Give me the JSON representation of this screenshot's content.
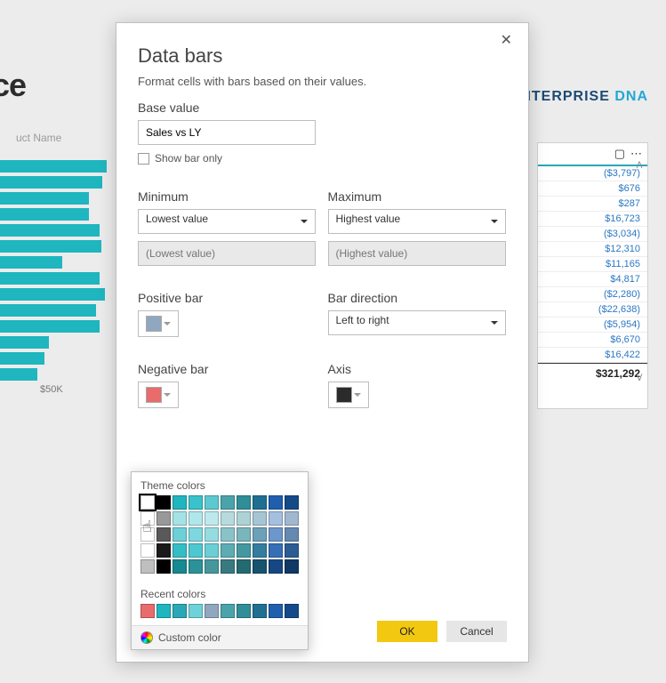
{
  "bg": {
    "title_fragment": "nce",
    "uct_label": "uct Name",
    "tick": "$50K",
    "logo_left": "NTERPRISE",
    "logo_right": " DNA",
    "bars_w": [
      120,
      115,
      100,
      100,
      112,
      114,
      70,
      112,
      118,
      108,
      112,
      55,
      50,
      42
    ]
  },
  "table": {
    "rows": [
      {
        "v": "($3,797)",
        "neg": true
      },
      {
        "v": "$676"
      },
      {
        "v": "$287"
      },
      {
        "v": "$16,723"
      },
      {
        "v": "($3,034)",
        "neg": true
      },
      {
        "v": "$12,310"
      },
      {
        "v": "$11,165"
      },
      {
        "v": "$4,817"
      },
      {
        "v": "($2,280)",
        "neg": true
      },
      {
        "v": "($22,638)",
        "neg": true
      },
      {
        "v": "($5,954)",
        "neg": true
      },
      {
        "v": "$6,670"
      },
      {
        "v": "$16,422"
      }
    ],
    "total": "$321,292"
  },
  "dlg": {
    "title": "Data bars",
    "subtitle": "Format cells with bars based on their values.",
    "base_label": "Base value",
    "base_value": "Sales vs LY",
    "show_bar_only": "Show bar only",
    "min_label": "Minimum",
    "max_label": "Maximum",
    "min_select": "Lowest value",
    "max_select": "Highest value",
    "min_placeholder": "(Lowest value)",
    "max_placeholder": "(Highest value)",
    "pos_label": "Positive bar",
    "dir_label": "Bar direction",
    "dir_select": "Left to right",
    "neg_label": "Negative bar",
    "axis_label": "Axis",
    "ok": "OK",
    "cancel": "Cancel",
    "pos_color": "#8fa8bf",
    "neg_color": "#e86c6c",
    "axis_color": "#2b2b2b"
  },
  "picker": {
    "theme_label": "Theme colors",
    "recent_label": "Recent colors",
    "custom_label": "Custom color",
    "theme_base": [
      "#ffffff",
      "#000000",
      "#1fb6c0",
      "#39c2cc",
      "#5cc9d0",
      "#4aa3ab",
      "#2f8e97",
      "#1f6f93",
      "#1f5fae",
      "#144a87"
    ],
    "recent": [
      "#e86c6c",
      "#1fb6c0",
      "#2aa8b5",
      "#6fd2d8",
      "#8fa8bf",
      "#4aa3ab",
      "#2f8e97",
      "#1f6f93",
      "#1f5fae",
      "#144a87"
    ]
  }
}
